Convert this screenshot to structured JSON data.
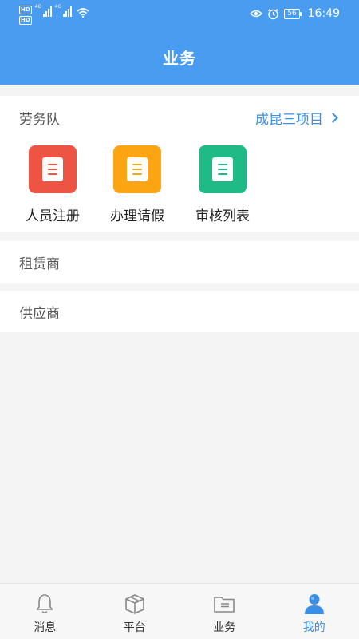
{
  "status_bar": {
    "hd_top": "HD",
    "hd_bottom": "HD",
    "net1": "4G",
    "net2": "4G",
    "battery": "56",
    "time": "16:49"
  },
  "header": {
    "title": "业务"
  },
  "labor": {
    "title": "劳务队",
    "project": "成昆三项目",
    "items": [
      {
        "label": "人员注册",
        "color": "#ee5443"
      },
      {
        "label": "办理请假",
        "color": "#fba512"
      },
      {
        "label": "审核列表",
        "color": "#1fba86"
      }
    ]
  },
  "rows": {
    "rental": "租赁商",
    "supplier": "供应商"
  },
  "tabs": [
    {
      "label": "消息",
      "icon": "bell-icon"
    },
    {
      "label": "平台",
      "icon": "box-icon"
    },
    {
      "label": "业务",
      "icon": "folder-icon"
    },
    {
      "label": "我的",
      "icon": "person-icon",
      "active": true
    }
  ],
  "colors": {
    "accent": "#4a9cf0",
    "link": "#3a8ee6"
  }
}
